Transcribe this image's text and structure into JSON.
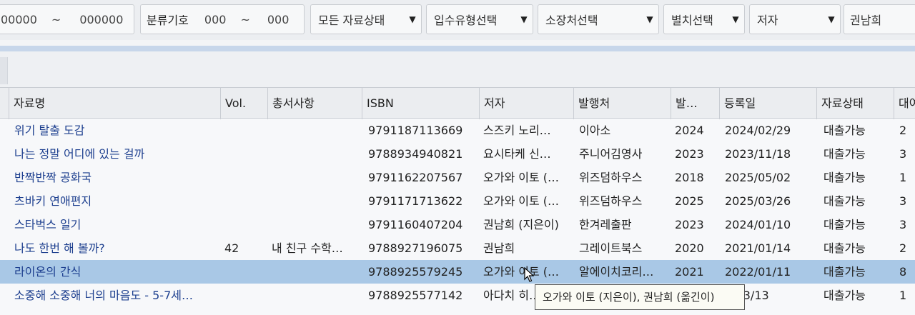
{
  "filters": {
    "reg_range": {
      "from": "00000",
      "sep": "~",
      "to": "000000"
    },
    "class_label": "분류기호",
    "class_range": {
      "from": "000",
      "sep": "~",
      "to": "000"
    },
    "status_select": "모든 자료상태",
    "acq_select": "입수유형선택",
    "location_select": "소장처선택",
    "extra_select": "별치선택",
    "field_select": "저자",
    "search_value": "권남희"
  },
  "table": {
    "columns": [
      "자료명",
      "Vol.",
      "총서사항",
      "ISBN",
      "저자",
      "발행처",
      "발…",
      "등록일",
      "자료상태",
      "대여"
    ],
    "rows": [
      {
        "title": "위기 탈출 도감",
        "vol": "",
        "series": "",
        "isbn": "9791187113669",
        "author": "스즈키 노리…",
        "publisher": "이아소",
        "year": "2024",
        "reg_date": "2024/02/29",
        "status": "대출가능",
        "count": "2"
      },
      {
        "title": "나는 정말 어디에 있는 걸까",
        "vol": "",
        "series": "",
        "isbn": "9788934940821",
        "author": "요시타케 신…",
        "publisher": "주니어김영사",
        "year": "2023",
        "reg_date": "2023/11/18",
        "status": "대출가능",
        "count": "3"
      },
      {
        "title": "반짝반짝 공화국",
        "vol": "",
        "series": "",
        "isbn": "9791162207567",
        "author": "오가와 이토 (…",
        "publisher": "위즈덤하우스",
        "year": "2018",
        "reg_date": "2025/05/02",
        "status": "대출가능",
        "count": "1"
      },
      {
        "title": "츠바키 연애편지",
        "vol": "",
        "series": "",
        "isbn": "9791171713622",
        "author": "오가와 이토 (…",
        "publisher": "위즈덤하우스",
        "year": "2025",
        "reg_date": "2025/03/26",
        "status": "대출가능",
        "count": "3"
      },
      {
        "title": "스타벅스 일기",
        "vol": "",
        "series": "",
        "isbn": "9791160407204",
        "author": "권남희 (지은이)",
        "publisher": "한겨레출판",
        "year": "2023",
        "reg_date": "2024/01/10",
        "status": "대출가능",
        "count": "3"
      },
      {
        "title": "나도 한번 해 볼까?",
        "vol": "42",
        "series": "내 친구 수학…",
        "isbn": "9788927196075",
        "author": "권남희",
        "publisher": "그레이트북스",
        "year": "2020",
        "reg_date": "2021/01/14",
        "status": "대출가능",
        "count": "2"
      },
      {
        "title": "라이온의 간식",
        "vol": "",
        "series": "",
        "isbn": "9788925579245",
        "author": "오가와 이토 (…",
        "publisher": "알에이치코리…",
        "year": "2021",
        "reg_date": "2022/01/11",
        "status": "대출가능",
        "count": "8"
      },
      {
        "title": "소중해 소중해 너의 마음도 - 5-7세…",
        "vol": "",
        "series": "",
        "isbn": "9788925577142",
        "author": "아다치 히…",
        "publisher": "",
        "year": "",
        "reg_date": "3/03/13",
        "status": "대출가능",
        "count": "1"
      }
    ],
    "selected_row": 6
  },
  "tooltip": "오가와 이토 (지은이), 권남희 (옮긴이)",
  "colors": {
    "title_link": "#1d3f8f",
    "selected_row": "#a9c8e6",
    "header_bg": "#ebedf0"
  }
}
